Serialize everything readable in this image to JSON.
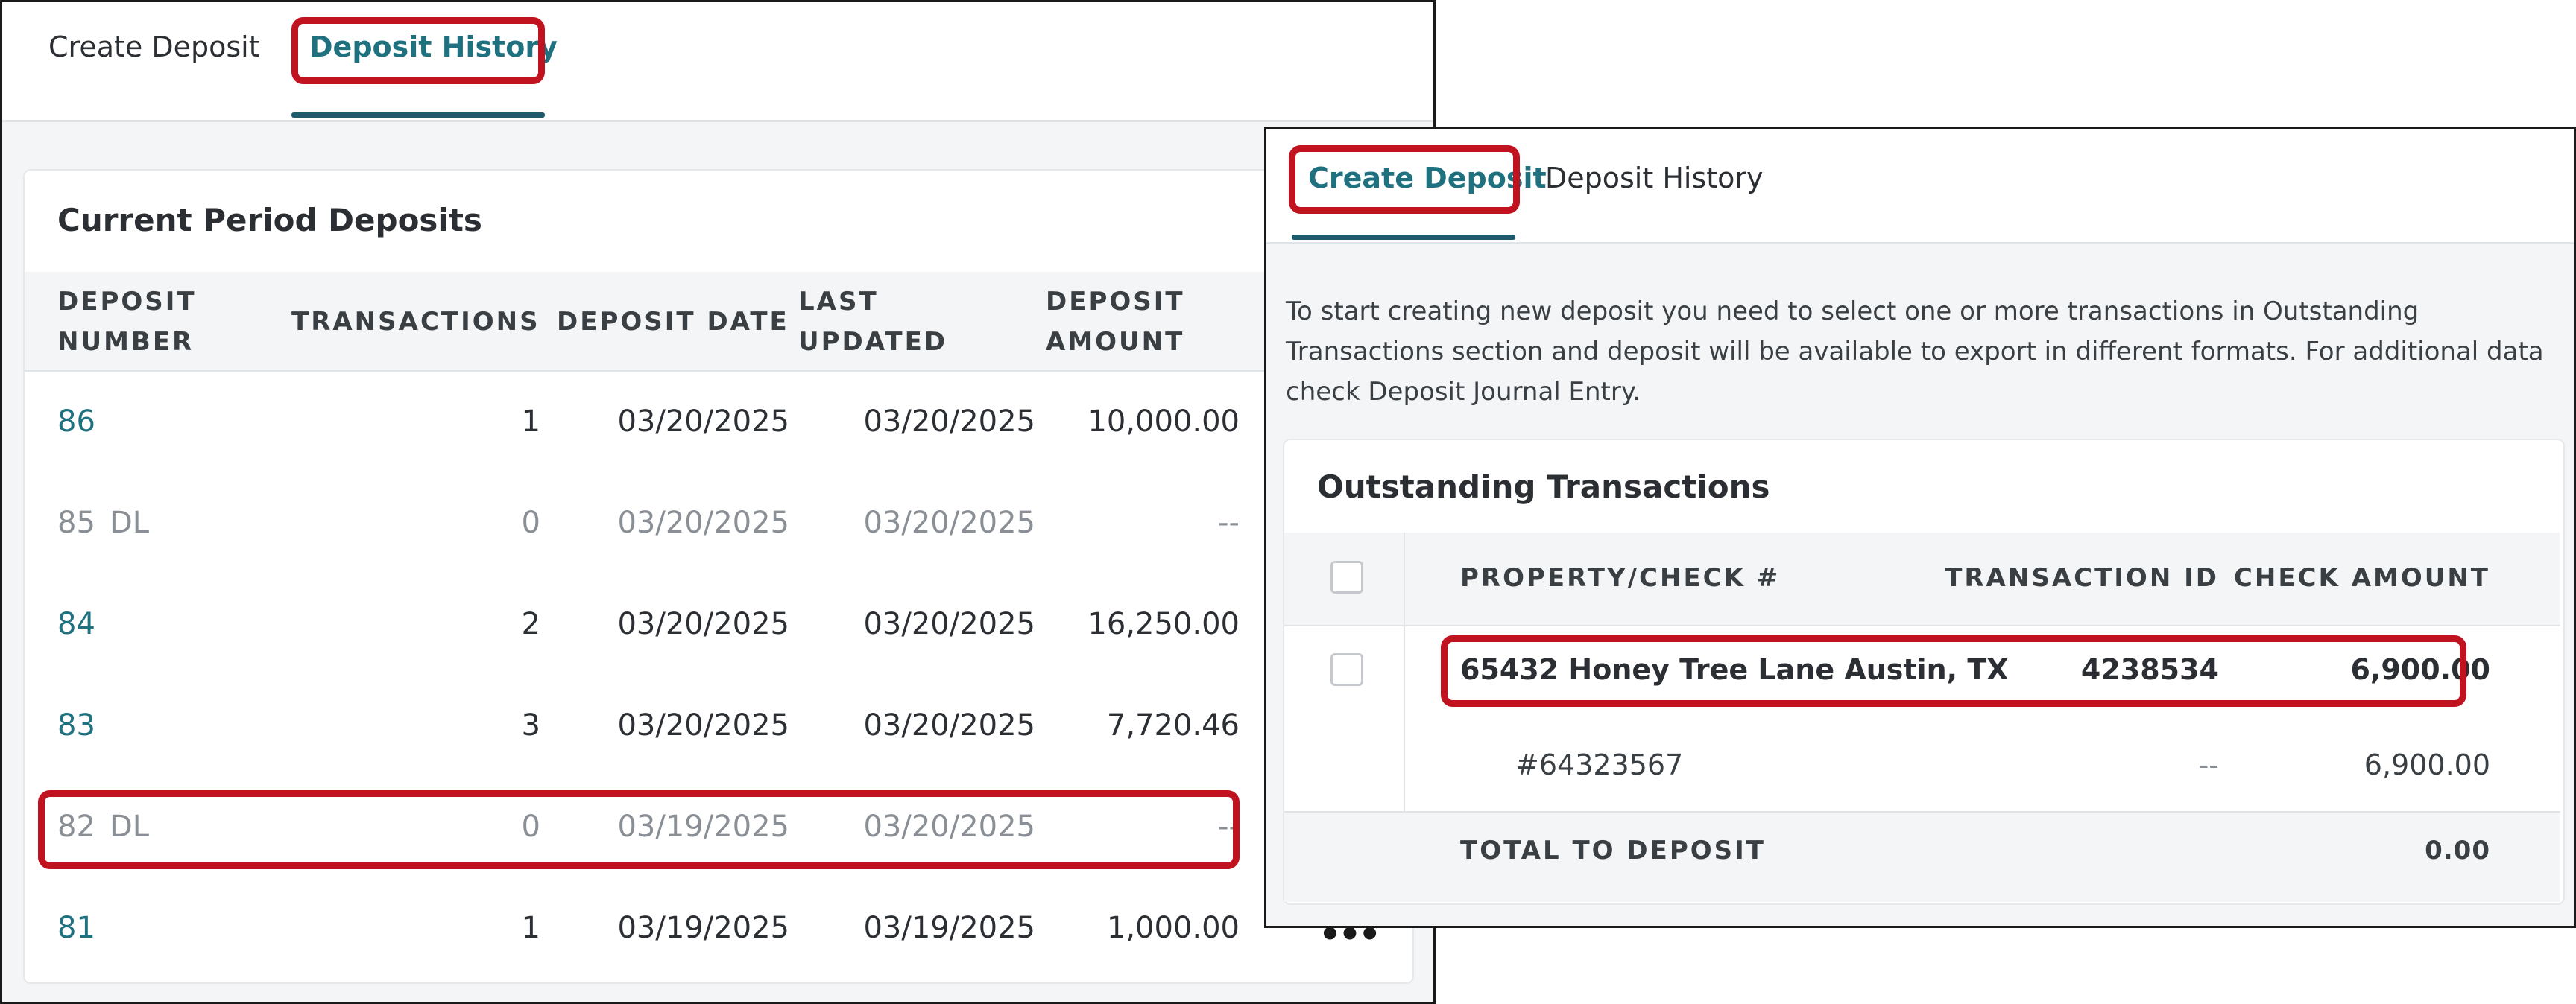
{
  "left_panel": {
    "tabs": [
      {
        "label": "Create Deposit",
        "active": false
      },
      {
        "label": "Deposit History",
        "active": true
      }
    ],
    "section_title": "Current Period Deposits",
    "columns": [
      {
        "line1": "DEPOSIT",
        "line2": "NUMBER"
      },
      {
        "line1": "TRANSACTIONS",
        "line2": ""
      },
      {
        "line1": "DEPOSIT DATE",
        "line2": ""
      },
      {
        "line1": "LAST",
        "line2": "UPDATED"
      },
      {
        "line1": "DEPOSIT",
        "line2": "AMOUNT"
      }
    ],
    "rows": [
      {
        "number": "86",
        "flag": "",
        "transactions": "1",
        "deposit_date": "03/20/2025",
        "last_updated": "03/20/2025",
        "amount": "10,000.00",
        "muted": false
      },
      {
        "number": "85",
        "flag": "DL",
        "transactions": "0",
        "deposit_date": "03/20/2025",
        "last_updated": "03/20/2025",
        "amount": "--",
        "muted": true
      },
      {
        "number": "84",
        "flag": "",
        "transactions": "2",
        "deposit_date": "03/20/2025",
        "last_updated": "03/20/2025",
        "amount": "16,250.00",
        "muted": false
      },
      {
        "number": "83",
        "flag": "",
        "transactions": "3",
        "deposit_date": "03/20/2025",
        "last_updated": "03/20/2025",
        "amount": "7,720.46",
        "muted": false
      },
      {
        "number": "82",
        "flag": "DL",
        "transactions": "0",
        "deposit_date": "03/19/2025",
        "last_updated": "03/20/2025",
        "amount": "--",
        "muted": true
      },
      {
        "number": "81",
        "flag": "",
        "transactions": "1",
        "deposit_date": "03/19/2025",
        "last_updated": "03/19/2025",
        "amount": "1,000.00",
        "muted": false
      }
    ],
    "more_icon": "•••"
  },
  "right_panel": {
    "tabs": [
      {
        "label": "Create Deposit",
        "active": true
      },
      {
        "label": "Deposit History",
        "active": false
      }
    ],
    "instructions": [
      "To start creating new deposit you need to select one or more transactions in Outstanding",
      "Transactions section and deposit will be available to export in different formats. For additional data",
      "check Deposit Journal Entry."
    ],
    "card_title": "Outstanding Transactions",
    "columns": {
      "property": "PROPERTY/CHECK #",
      "transaction_id": "TRANSACTION ID",
      "check_amount": "CHECK AMOUNT"
    },
    "transaction": {
      "property": "65432 Honey Tree Lane Austin, TX",
      "transaction_id": "4238534",
      "amount": "6,900.00"
    },
    "check": {
      "number": "#64323567",
      "transaction_id": "--",
      "amount": "6,900.00"
    },
    "total": {
      "label": "TOTAL TO DEPOSIT",
      "value": "0.00"
    }
  },
  "colors": {
    "accent": "#1f7180",
    "highlight": "#c1121f",
    "tab_underline": "#1c5a6c"
  }
}
